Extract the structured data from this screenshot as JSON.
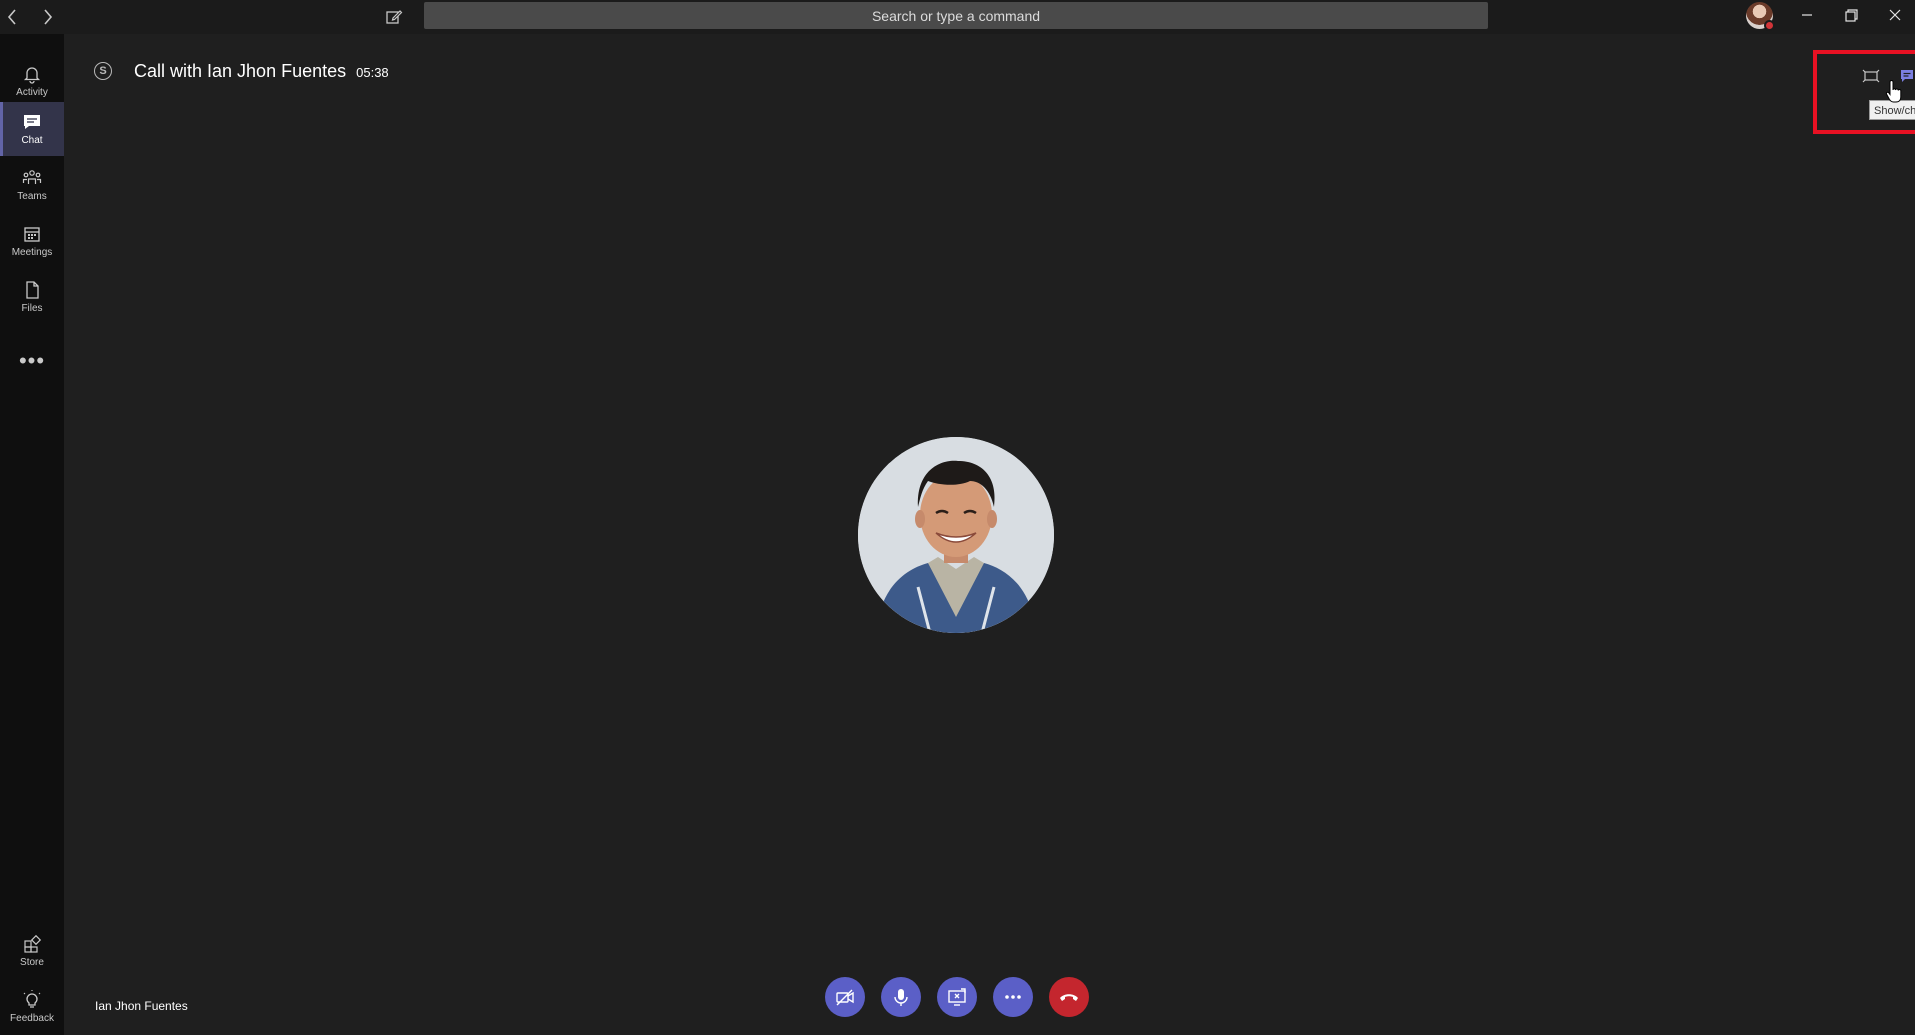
{
  "titlebar": {
    "back_icon": "chevron-left-icon",
    "forward_icon": "chevron-right-icon",
    "compose_icon": "compose-icon",
    "search_placeholder": "Search or type a command",
    "presence_color": "#d13438"
  },
  "rail": {
    "items": [
      {
        "label": "Activity",
        "icon": "bell-icon",
        "active": false
      },
      {
        "label": "Chat",
        "icon": "chat-icon",
        "active": true
      },
      {
        "label": "Teams",
        "icon": "teams-icon",
        "active": false
      },
      {
        "label": "Meetings",
        "icon": "calendar-icon",
        "active": false
      },
      {
        "label": "Files",
        "icon": "file-icon",
        "active": false
      }
    ],
    "more_label": "•••",
    "bottom": [
      {
        "label": "Store",
        "icon": "store-icon"
      },
      {
        "label": "Feedback",
        "icon": "lightbulb-icon"
      }
    ]
  },
  "call": {
    "title": "Call with Ian Jhon Fuentes",
    "timer": "05:38",
    "participant_name": "Ian Jhon Fuentes"
  },
  "top_controls": {
    "tooltip": "Show/choose devi",
    "highlight_color": "#e81123"
  },
  "call_controls": [
    {
      "name": "camera-off-button",
      "icon": "camera-off-icon"
    },
    {
      "name": "mic-button",
      "icon": "microphone-icon"
    },
    {
      "name": "share-screen-button",
      "icon": "share-screen-icon"
    },
    {
      "name": "more-actions-button",
      "icon": "more-icon"
    },
    {
      "name": "hang-up-button",
      "icon": "hang-up-icon"
    }
  ],
  "colors": {
    "accent": "#5b5fc7",
    "hangup": "#c4262e",
    "rail_active": "#33344a"
  }
}
